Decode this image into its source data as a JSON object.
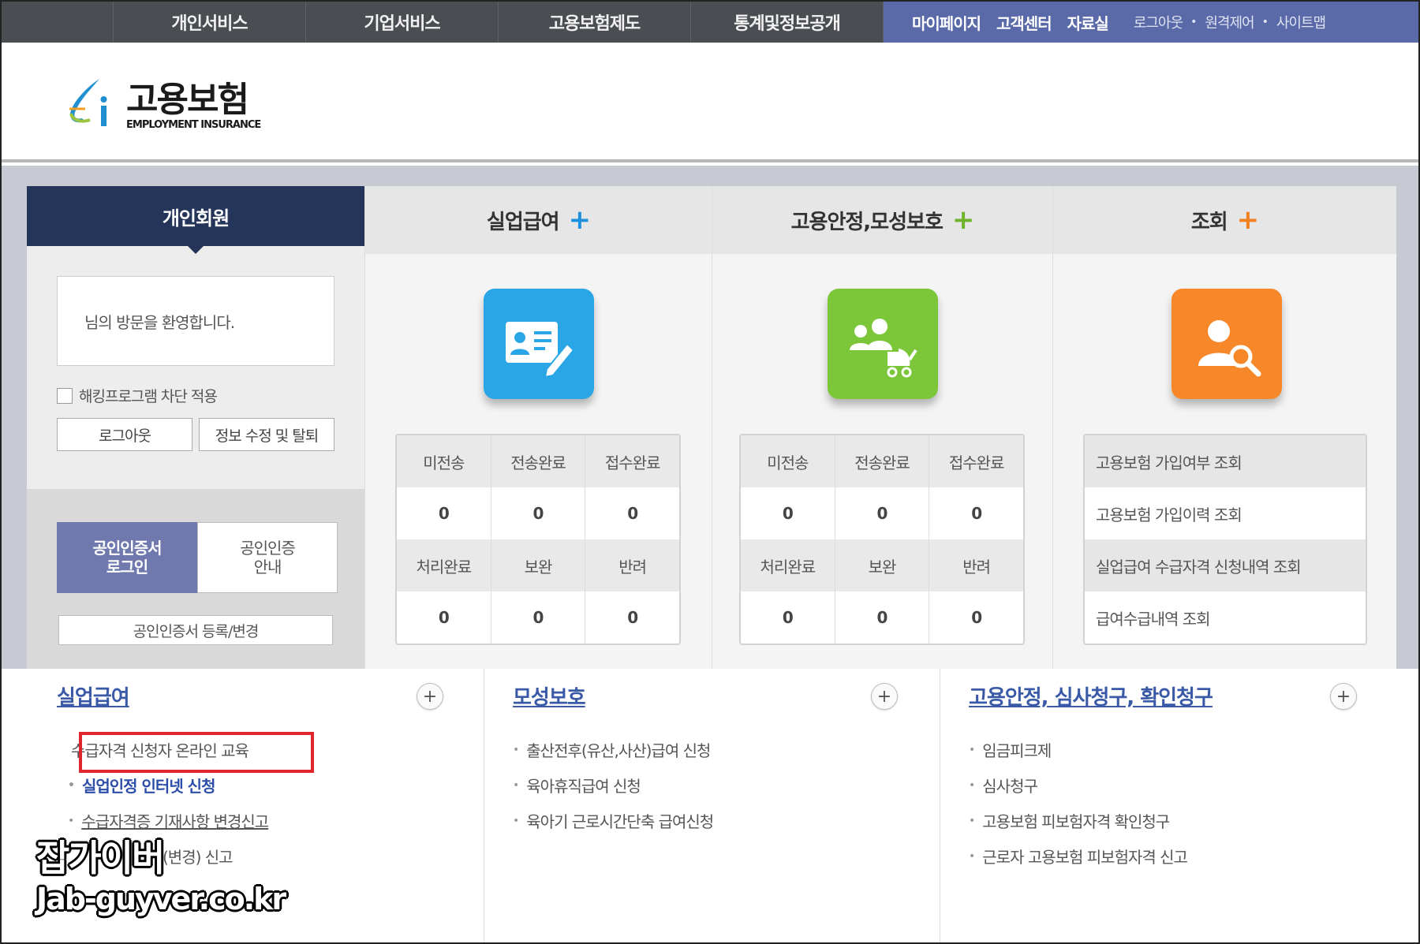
{
  "topnav": {
    "items": [
      "개인서비스",
      "기업서비스",
      "고용보험제도",
      "통계및정보공개"
    ],
    "util_strong": [
      "마이페이지",
      "고객센터",
      "자료실"
    ],
    "util_light": [
      "로그아웃",
      "원격제어",
      "사이트맵"
    ],
    "colors": {
      "bar": "#4a4d52",
      "util": "#5a6aa8"
    }
  },
  "logo": {
    "name": "고용보험",
    "subtitle": "EMPLOYMENT INSURANCE"
  },
  "member": {
    "title": "개인회원",
    "welcome": "님의 방문을 환영합니다.",
    "hacking_block": "해킹프로그램 차단 적용",
    "logout": "로그아웃",
    "edit": "정보 수정 및 탈퇴",
    "cert_login": [
      "공인인증서",
      "로그인"
    ],
    "cert_guide": [
      "공인인증",
      "안내"
    ],
    "cert_register": "공인인증서 등록/변경"
  },
  "columns": [
    {
      "title": "실업급여",
      "plus_color": "#1f8fe0",
      "icon": "id-card-edit-icon",
      "icon_color": "#2aa5e6",
      "labels_top": [
        "미전송",
        "전송완료",
        "접수완료"
      ],
      "values_top": [
        "0",
        "0",
        "0"
      ],
      "labels_bottom": [
        "처리완료",
        "보완",
        "반려"
      ],
      "values_bottom": [
        "0",
        "0",
        "0"
      ]
    },
    {
      "title": "고용안정,모성보호",
      "plus_color": "#6fb22b",
      "icon": "family-stroller-icon",
      "icon_color": "#7cc63a",
      "labels_top": [
        "미전송",
        "전송완료",
        "접수완료"
      ],
      "values_top": [
        "0",
        "0",
        "0"
      ],
      "labels_bottom": [
        "처리완료",
        "보완",
        "반려"
      ],
      "values_bottom": [
        "0",
        "0",
        "0"
      ]
    },
    {
      "title": "조회",
      "plus_color": "#f08020",
      "icon": "user-search-icon",
      "icon_color": "#f7882a",
      "queries": [
        "고용보험 가입여부 조회",
        "고용보험 가입이력 조회",
        "실업급여 수급자격 신청내역 조회",
        "급여수급내역 조회"
      ]
    }
  ],
  "bottom": {
    "sections": [
      {
        "title": "실업급여",
        "items": [
          "수급자격 신청자 온라인 교육",
          "실업인정 인터넷 신청",
          "수급자격증 기재사항 변경신고",
          "(변경) 신고"
        ]
      },
      {
        "title": "모성보호",
        "items": [
          "출산전후(유산,사산)급여 신청",
          "육아휴직급여 신청",
          "육아기 근로시간단축 급여신청"
        ]
      },
      {
        "title": "고용안정, 심사청구, 확인청구",
        "items": [
          "임금피크제",
          "심사청구",
          "고용보험 피보험자격 확인청구",
          "근로자 고용보험 피보험자격 신고"
        ]
      }
    ]
  },
  "watermark": {
    "name": "잡가이버",
    "url": "Jab-guyver.co.kr"
  }
}
